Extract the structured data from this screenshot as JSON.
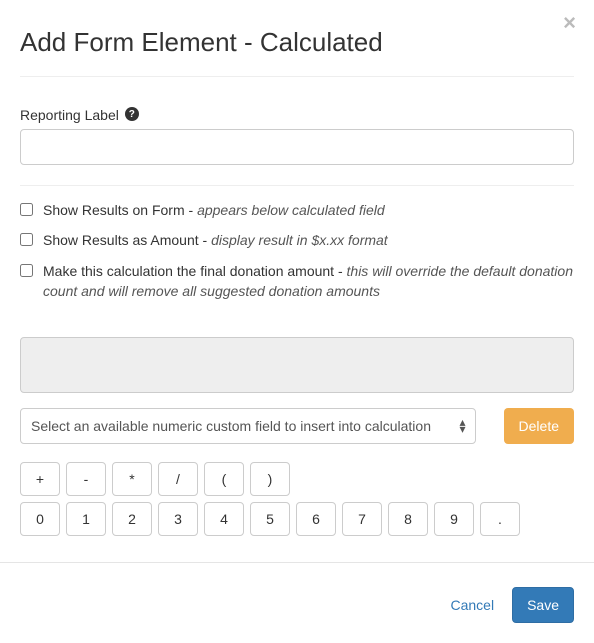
{
  "modal": {
    "title": "Add Form Element - Calculated",
    "close": "×"
  },
  "reporting": {
    "label": "Reporting Label",
    "value": ""
  },
  "checks": {
    "show_results": "Show Results on Form - ",
    "show_results_hint": "appears below calculated field",
    "show_amount": "Show Results as Amount - ",
    "show_amount_hint": "display result in $x.xx format",
    "final_donation": "Make this calculation the final donation amount - ",
    "final_donation_hint": "this will override the default donation count and will remove all suggested donation amounts"
  },
  "calc": {
    "value": "",
    "select_placeholder": "Select an available numeric custom field to insert into calculation",
    "delete": "Delete"
  },
  "keypad": {
    "ops": [
      "+",
      "-",
      "*",
      "/",
      "(",
      ")"
    ],
    "nums": [
      "0",
      "1",
      "2",
      "3",
      "4",
      "5",
      "6",
      "7",
      "8",
      "9",
      "."
    ]
  },
  "footer": {
    "cancel": "Cancel",
    "save": "Save"
  }
}
